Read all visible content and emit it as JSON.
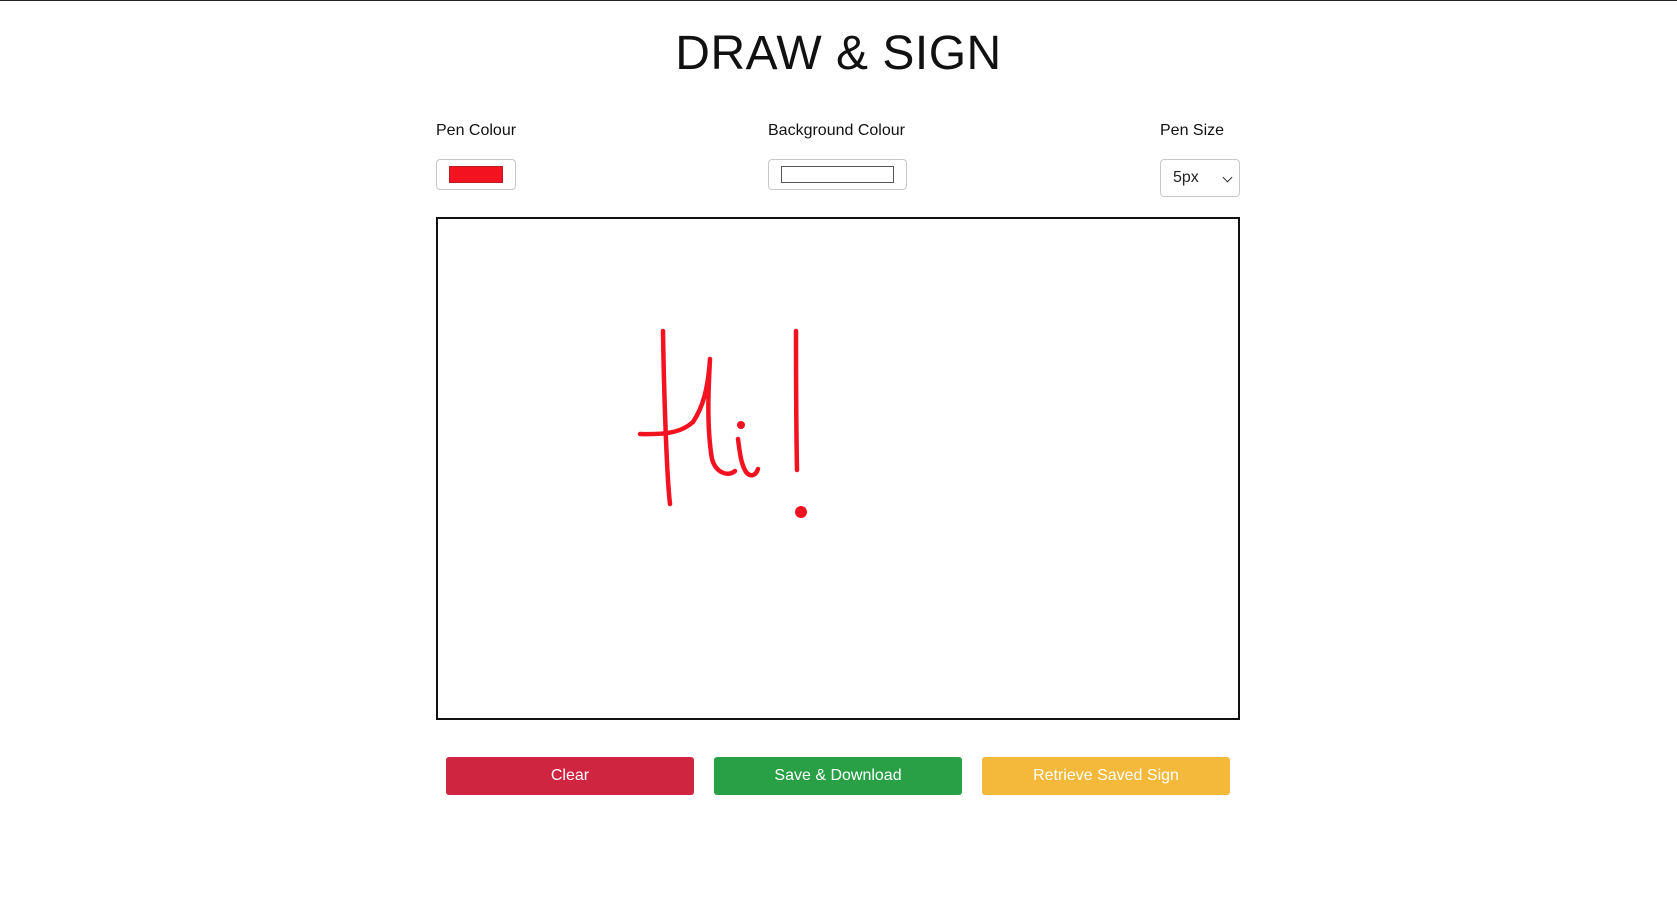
{
  "page": {
    "title": "DRAW & SIGN"
  },
  "controls": {
    "pen_colour": {
      "label": "Pen Colour",
      "value": "#f3121f"
    },
    "background_colour": {
      "label": "Background Colour",
      "value": "#ffffff"
    },
    "pen_size": {
      "label": "Pen Size",
      "selected": "5px"
    }
  },
  "canvas": {
    "drawing": "handwritten signature reading \"Hi!\""
  },
  "buttons": {
    "clear": {
      "label": "Clear",
      "color": "#cf2540"
    },
    "save": {
      "label": "Save & Download",
      "color": "#29a046"
    },
    "retrieve": {
      "label": "Retrieve Saved Sign",
      "color": "#f4b93b"
    }
  }
}
